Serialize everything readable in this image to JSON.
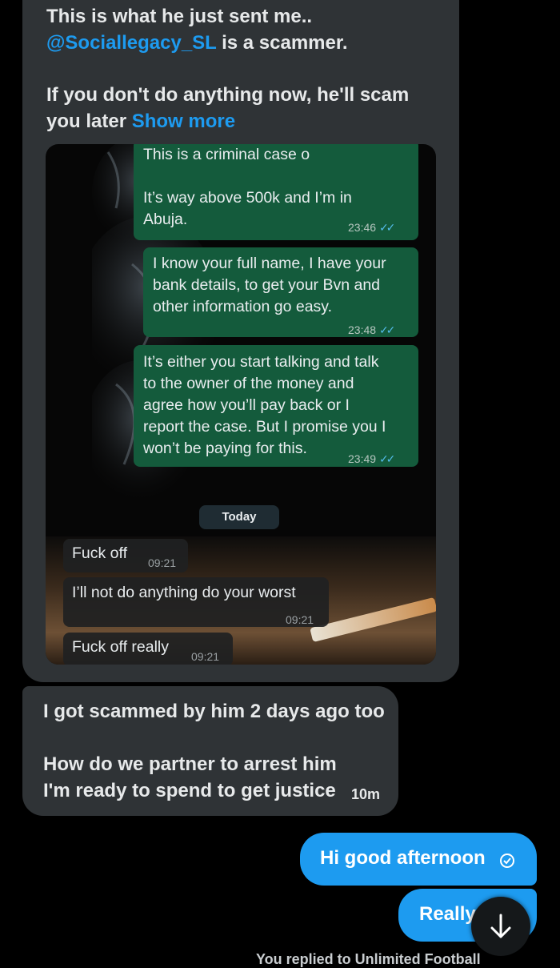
{
  "dm_1": {
    "line1": "This is what he just sent me..",
    "mention": "@Sociallegacy_SL",
    "line2_rest": " is a scammer.",
    "line3": "If you don't do anything now, he'll scam",
    "line4": "you later ",
    "show_more": "Show more",
    "screenshot": {
      "msg_a_line1": "This is a criminal case o",
      "msg_a_line2": "It’s way above 500k and I’m in",
      "msg_a_line3": "Abuja.",
      "msg_a_time": "23:46",
      "msg_b_line1": "I know your full name, I have your",
      "msg_b_line2": "bank details, to get your Bvn and",
      "msg_b_line3": "other information go easy.",
      "msg_b_time": "23:48",
      "msg_c_line1": "It’s either you start talking and talk",
      "msg_c_line2": "to the owner of the money and",
      "msg_c_line3": "agree how you’ll pay back or I",
      "msg_c_line4": "report the case. But I promise you I",
      "msg_c_line5": "won’t be paying for this.",
      "msg_c_time": "23:49",
      "date_divider": "Today",
      "reply_1": "Fuck off",
      "reply_1_time": "09:21",
      "reply_2": "I’ll not do anything do your worst",
      "reply_2_time": "09:21",
      "reply_3": "Fuck off really",
      "reply_3_time": "09:21"
    }
  },
  "dm_2": {
    "line1": "I got scammed by him 2 days ago too",
    "line2": "How do we partner to arrest him",
    "line3": "I'm ready to spend to get justice",
    "time": "10m"
  },
  "outgoing": {
    "msg1": "Hi good afternoon",
    "msg2": "Really"
  },
  "bottom_note": "You replied to Unlimited Football",
  "colors": {
    "accent": "#1d9bf0",
    "incoming_bubble": "#2f3336",
    "whatsapp_out": "#145b3c"
  },
  "icons": [
    "check-circle-icon",
    "arrow-down-icon",
    "double-check-icon"
  ]
}
